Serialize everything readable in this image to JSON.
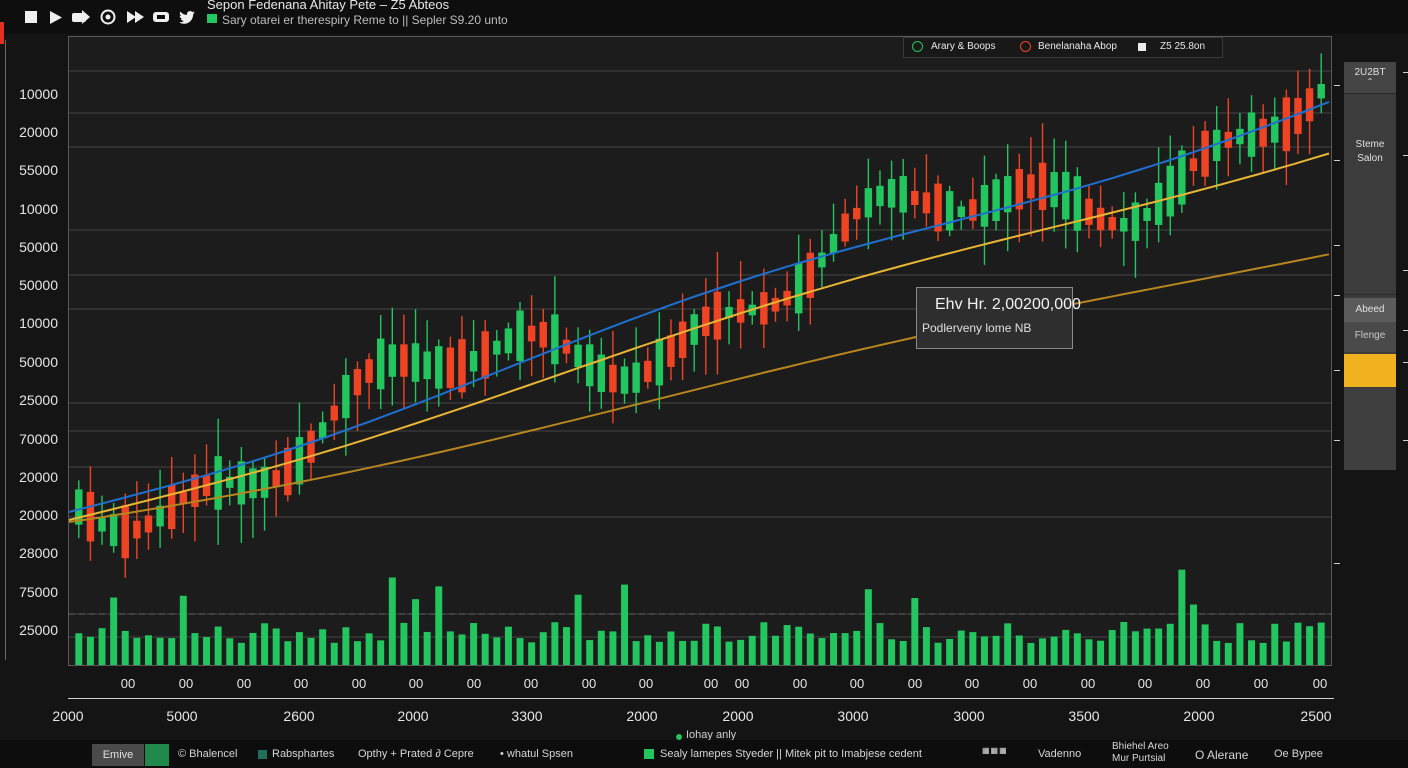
{
  "window": {
    "title": "Sepon Fedenana Ahitay Pete – Z5 Abteos",
    "subtitle": "Sary otarei er therespiry Reme to || Sepler S9.20 unto"
  },
  "toolbar": {
    "icons": [
      "stop-icon",
      "play-icon",
      "replay-icon",
      "target-icon",
      "fast-forward-icon",
      "video-icon",
      "twitter-icon"
    ]
  },
  "y_axis_labels": [
    "10000",
    "20000",
    "55000",
    "10000",
    "50000",
    "50000",
    "10000",
    "50000",
    "25000",
    "70000",
    "20000",
    "20000",
    "28000",
    "75000",
    "25000"
  ],
  "x_axis_labels_small": [
    "00",
    "00",
    "00",
    "00",
    "00",
    "00",
    "00",
    "00",
    "00",
    "00",
    "00",
    "00",
    "00",
    "00",
    "00",
    "00",
    "00",
    "00",
    "00",
    "00",
    "00"
  ],
  "x_axis_labels": [
    "2000",
    "5000",
    "2600",
    "2000",
    "3300",
    "2000",
    "2000",
    "3000",
    "3000",
    "3500",
    "2000",
    "2500"
  ],
  "legend": {
    "item1": "Arary & Boops",
    "item2": "Benelanaha Abop",
    "item3": "Z5 25.8on"
  },
  "tooltip": {
    "line1": "Ehv Hr. 2,00200,000",
    "line2": "Podlerveny lome NB"
  },
  "right_panel": {
    "box1_value": "2U2BT",
    "box2_line1": "Steme",
    "box2_line2": "Salon",
    "box3_title": "Abeed",
    "box3_sub": "Flenge"
  },
  "marker_label": "Iohay anly",
  "bottom_bar": {
    "left_button": "Emive",
    "items": [
      "© Bhalencel",
      "Rabsphartes",
      "Opthy + Prated ∂ Cepre",
      "• whatul Spsen",
      "Sealy lamepes Styeder || Mitek pit to Imabjese cedent",
      "Vadenno",
      "Bhiehel Areo Mur Purtsial",
      "O Alerane",
      "Oe Bypee"
    ]
  },
  "colors": {
    "up": "#22c55e",
    "down": "#ef4423",
    "blue_line": "#1f6fd1",
    "yellow_line": "#e9b534",
    "orange_line": "#b7861f",
    "volume": "#22c55e",
    "highlight": "#f2b21f"
  },
  "chart_data": {
    "type": "candlestick",
    "title": "Sepon Fedenana Ahitay Pete – Z5 Abteos",
    "y_tick_labels": [
      "10000",
      "20000",
      "55000",
      "10000",
      "50000",
      "50000",
      "10000",
      "50000",
      "25000",
      "70000",
      "20000",
      "20000",
      "28000",
      "75000",
      "25000"
    ],
    "x_tick_labels": [
      "2000",
      "5000",
      "2600",
      "2000",
      "3300",
      "2000",
      "2000",
      "3000",
      "3000",
      "3500",
      "2000",
      "2500"
    ],
    "series": [
      {
        "name": "Arary & Boops",
        "role": "blue moving average"
      },
      {
        "name": "Benelanaha Abop",
        "role": "yellow moving average"
      },
      {
        "name": "Z5 25.8on",
        "role": "orange moving average"
      }
    ],
    "candles_description": "Uptrend of ~108 candles rising from bottom-left to top-right with volume bars below",
    "grid": true,
    "legend_position": "top-right"
  }
}
